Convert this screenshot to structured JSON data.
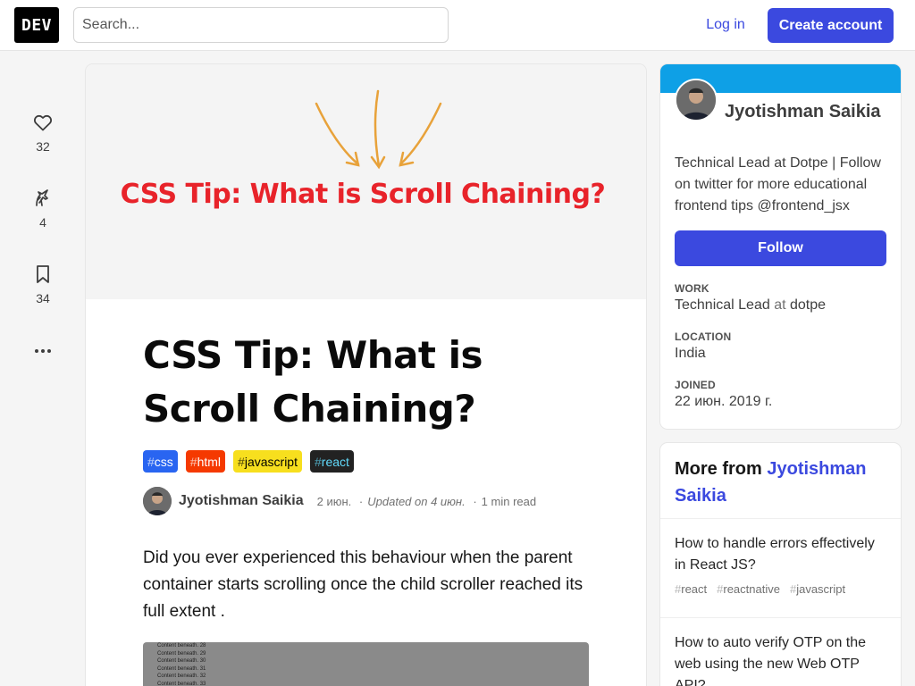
{
  "header": {
    "logo": "DEV",
    "search_placeholder": "Search...",
    "login_label": "Log in",
    "create_account_label": "Create account"
  },
  "reactions": {
    "likes": "32",
    "unicorns": "4",
    "bookmarks": "34"
  },
  "article": {
    "cover_title": "CSS Tip: What is Scroll Chaining?",
    "title": "CSS Tip: What is Scroll Chaining?",
    "tags": [
      {
        "name": "css",
        "bg": "#2965f1",
        "fg": "#ffffff"
      },
      {
        "name": "html",
        "bg": "#f53900",
        "fg": "#ffffff"
      },
      {
        "name": "javascript",
        "bg": "#f7df1e",
        "fg": "#000000"
      },
      {
        "name": "react",
        "bg": "#222222",
        "fg": "#61dafb"
      }
    ],
    "author": "Jyotishman Saikia",
    "date": "2 июн.",
    "updated": "Updated on 4 июн.",
    "read_time": "1 min read",
    "intro": "Did you ever experienced this behaviour when the parent container starts scrolling once the child scroller reached its full extent .",
    "gif_lines": [
      "Content beneath. 28",
      "Content beneath. 29",
      "Content beneath. 30",
      "Content beneath. 31",
      "Content beneath. 32",
      "Content beneath. 33"
    ]
  },
  "profile": {
    "name": "Jyotishman Saikia",
    "bio": "Technical Lead at Dotpe | Follow on twitter for more educational frontend tips @frontend_jsx",
    "follow_label": "Follow",
    "work_label": "WORK",
    "work_title": "Technical Lead",
    "work_at": "at",
    "work_company": "dotpe",
    "location_label": "LOCATION",
    "location": "India",
    "joined_label": "JOINED",
    "joined": "22 июн. 2019 г."
  },
  "more_from": {
    "prefix": "More from",
    "author": "Jyotishman Saikia",
    "items": [
      {
        "title": "How to handle errors effectively in React JS?",
        "tags": [
          "react",
          "reactnative",
          "javascript"
        ]
      },
      {
        "title": "How to auto verify OTP on the web using the new Web OTP API?",
        "tags": []
      }
    ]
  },
  "colors": {
    "accent": "#3b49df",
    "profile_band": "#0ea0e6",
    "cover_title": "#e8232a"
  }
}
